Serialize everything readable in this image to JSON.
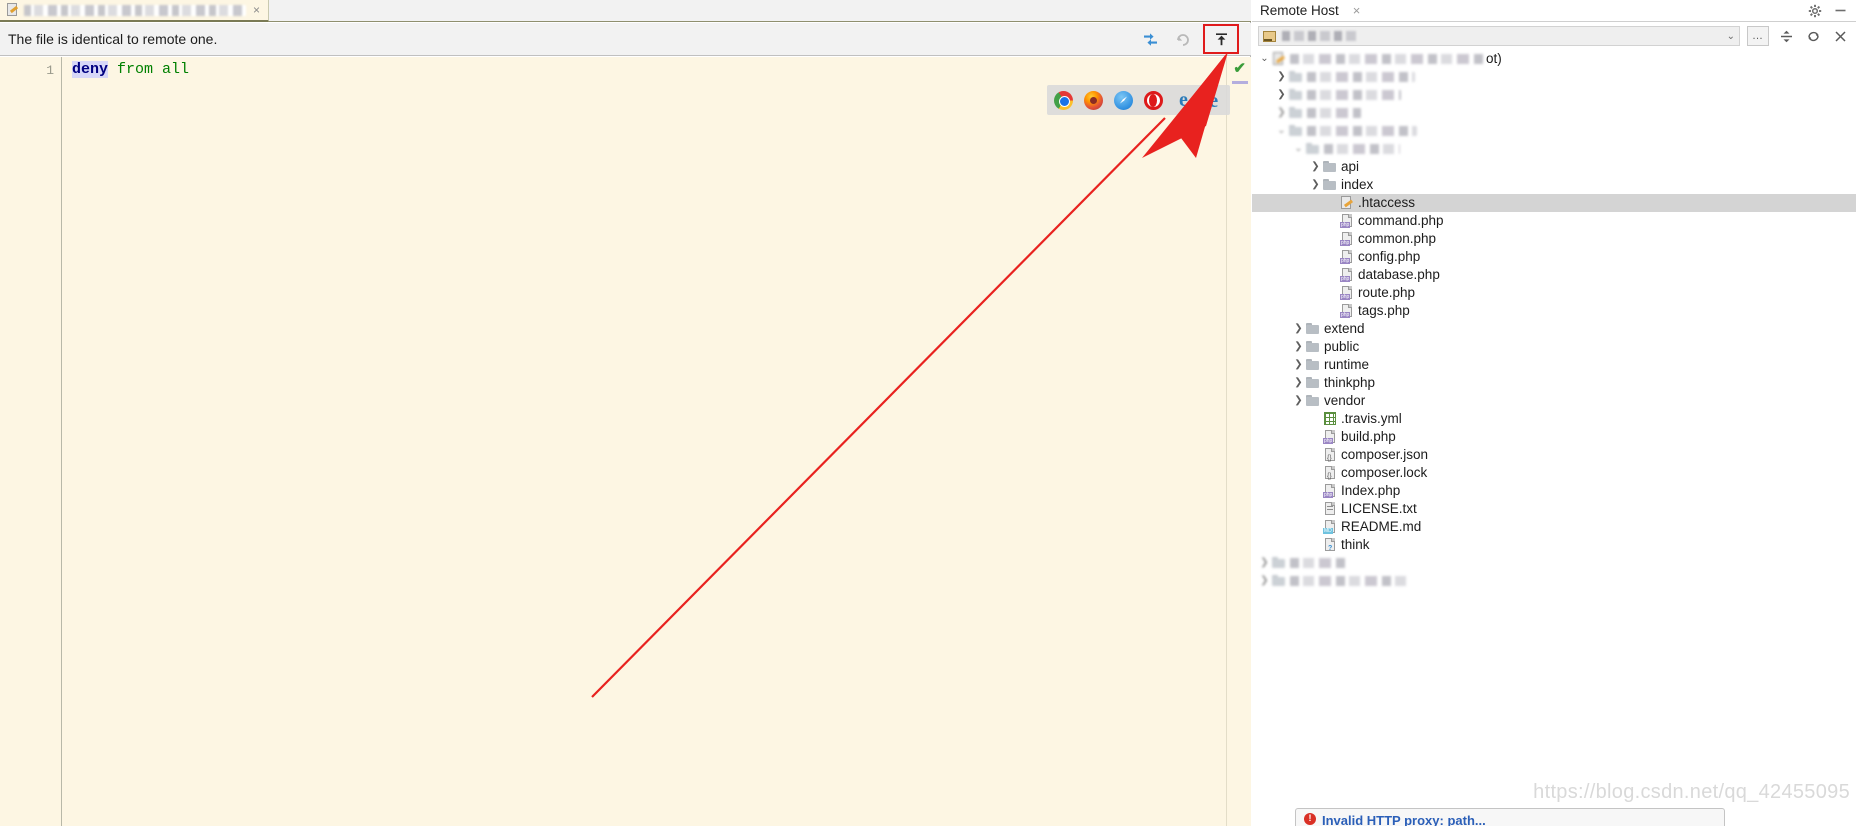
{
  "editor": {
    "tab": {
      "icon": "file-edit-icon",
      "title_redacted": true,
      "title": "",
      "close_label": "×"
    },
    "sync_message": "The file is identical to remote one.",
    "toolbar": {
      "diff_label": "→←",
      "undo_label": "↶",
      "upload_label": "⤓",
      "upload_highlight_color": "#e01b1b"
    },
    "gutter": {
      "line_numbers": [
        "1"
      ]
    },
    "code": {
      "tokens": [
        {
          "text": "deny",
          "kind": "keyword",
          "selected": true
        },
        {
          "text": " ",
          "kind": "plain"
        },
        {
          "text": "from all",
          "kind": "value"
        }
      ],
      "plain_text": "deny from all"
    },
    "inspection": {
      "status": "ok",
      "glyph": "✔"
    },
    "browser_preview": {
      "icons": [
        {
          "name": "chrome-icon",
          "label": "Chrome"
        },
        {
          "name": "firefox-icon",
          "label": "Firefox"
        },
        {
          "name": "safari-icon",
          "label": "Safari"
        },
        {
          "name": "opera-icon",
          "label": "Opera"
        },
        {
          "name": "internet-explorer-icon",
          "label": "Internet Explorer"
        },
        {
          "name": "edge-icon",
          "label": "Edge"
        }
      ]
    }
  },
  "annotation": {
    "type": "arrow",
    "color": "#e8221f",
    "points_to": "upload-button"
  },
  "remote_panel": {
    "tab_label": "Remote Host",
    "tab_close": "×",
    "header_icons": [
      {
        "name": "gear-icon",
        "glyph": "⚙"
      },
      {
        "name": "minimize-icon",
        "glyph": "–"
      }
    ],
    "toolbar": {
      "server_name_redacted": true,
      "server_name": "",
      "dropdown_glyph": "⌄",
      "browse_label": "…",
      "collapse_all_glyph": "⤓",
      "refresh_glyph": "↻",
      "close_glyph": "✕"
    },
    "tree": [
      {
        "depth": 0,
        "twist": "expanded",
        "icon": "server-root-icon",
        "label": "ot)",
        "redacted": true,
        "blur_width": 196,
        "suffix_visible": "ot)"
      },
      {
        "depth": 1,
        "twist": "collapsed",
        "icon": "folder-icon",
        "label": "",
        "redacted": true,
        "blur_width": 108
      },
      {
        "depth": 1,
        "twist": "collapsed",
        "icon": "folder-icon",
        "label": "",
        "redacted": true,
        "blur_width": 94
      },
      {
        "depth": 1,
        "twist": "none-blurred",
        "icon": "folder-icon",
        "label": "",
        "redacted": true,
        "blur_width": 54
      },
      {
        "depth": 1,
        "twist": "expanded-blurred",
        "icon": "folder-icon",
        "label": "",
        "redacted": true,
        "blur_width": 110
      },
      {
        "depth": 2,
        "twist": "expanded-blurred",
        "icon": "folder-icon",
        "label": "",
        "redacted": true,
        "blur_width": 76
      },
      {
        "depth": 3,
        "twist": "collapsed",
        "icon": "folder-icon",
        "label": "api"
      },
      {
        "depth": 3,
        "twist": "collapsed",
        "icon": "folder-icon",
        "label": "index"
      },
      {
        "depth": 4,
        "twist": "none",
        "icon": "htaccess-file-icon",
        "label": ".htaccess",
        "selected": true
      },
      {
        "depth": 4,
        "twist": "none",
        "icon": "php-file-icon",
        "label": "command.php"
      },
      {
        "depth": 4,
        "twist": "none",
        "icon": "php-file-icon",
        "label": "common.php"
      },
      {
        "depth": 4,
        "twist": "none",
        "icon": "php-file-icon",
        "label": "config.php"
      },
      {
        "depth": 4,
        "twist": "none",
        "icon": "php-file-icon",
        "label": "database.php"
      },
      {
        "depth": 4,
        "twist": "none",
        "icon": "php-file-icon",
        "label": "route.php"
      },
      {
        "depth": 4,
        "twist": "none",
        "icon": "php-file-icon",
        "label": "tags.php"
      },
      {
        "depth": 2,
        "twist": "collapsed",
        "icon": "folder-icon",
        "label": "extend"
      },
      {
        "depth": 2,
        "twist": "collapsed",
        "icon": "folder-icon",
        "label": "public"
      },
      {
        "depth": 2,
        "twist": "collapsed",
        "icon": "folder-icon",
        "label": "runtime"
      },
      {
        "depth": 2,
        "twist": "collapsed",
        "icon": "folder-icon",
        "label": "thinkphp"
      },
      {
        "depth": 2,
        "twist": "collapsed",
        "icon": "folder-icon",
        "label": "vendor"
      },
      {
        "depth": 3,
        "twist": "none",
        "icon": "yaml-file-icon",
        "label": ".travis.yml"
      },
      {
        "depth": 3,
        "twist": "none",
        "icon": "php-file-icon",
        "label": "build.php"
      },
      {
        "depth": 3,
        "twist": "none",
        "icon": "json-file-icon",
        "label": "composer.json"
      },
      {
        "depth": 3,
        "twist": "none",
        "icon": "json-file-icon",
        "label": "composer.lock"
      },
      {
        "depth": 3,
        "twist": "none",
        "icon": "php-file-icon",
        "label": "Index.php"
      },
      {
        "depth": 3,
        "twist": "none",
        "icon": "text-file-icon",
        "label": "LICENSE.txt"
      },
      {
        "depth": 3,
        "twist": "none",
        "icon": "markdown-file-icon",
        "label": "README.md"
      },
      {
        "depth": 3,
        "twist": "none",
        "icon": "unknown-file-icon",
        "label": "think"
      },
      {
        "depth": 0,
        "twist": "none-blurred",
        "icon": "folder-icon",
        "label": "",
        "redacted": true,
        "blur_width": 58
      },
      {
        "depth": 0,
        "twist": "none-blurred",
        "icon": "folder-icon",
        "label": "",
        "redacted": true,
        "blur_width": 118
      }
    ]
  },
  "watermark": {
    "text": "https://blog.csdn.net/qq_42455095"
  },
  "bottom_balloon": {
    "error_glyph": "!",
    "text": "Invalid HTTP proxy: path..."
  }
}
